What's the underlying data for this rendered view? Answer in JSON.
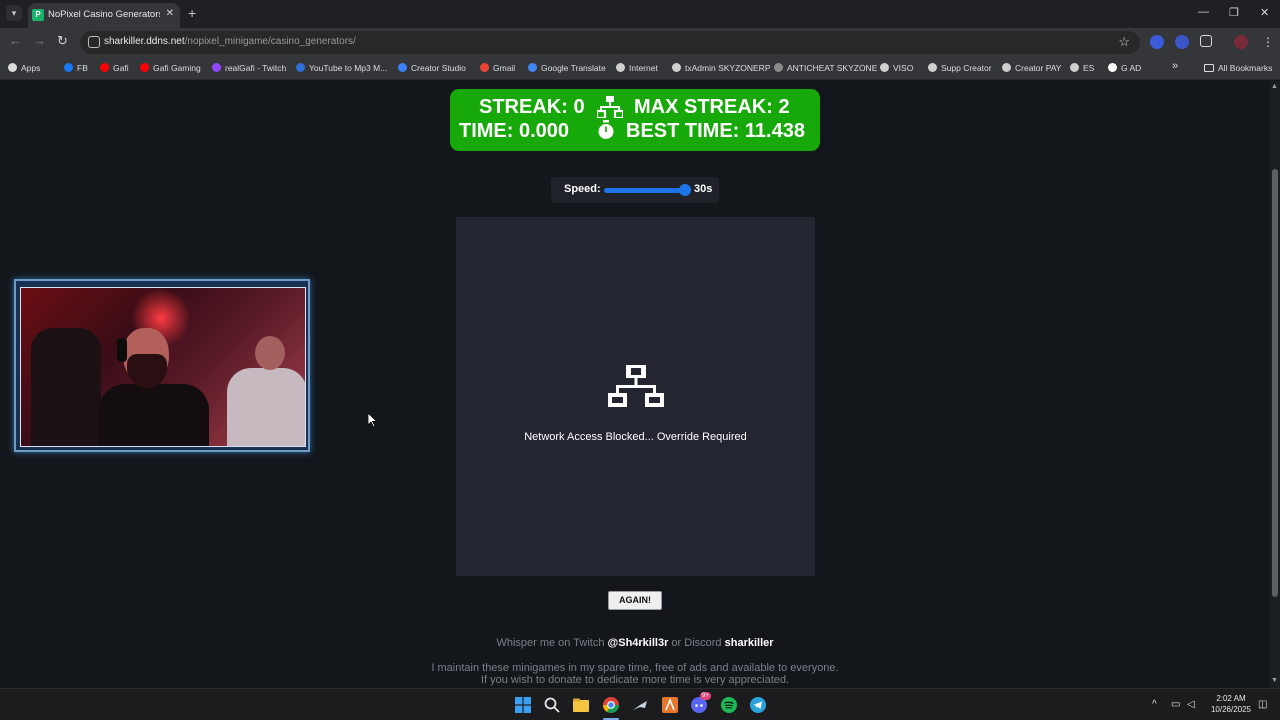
{
  "browser": {
    "tab_title": "NoPixel Casino Generators Mini",
    "url_host": "sharkiller.ddns.net",
    "url_path": "/nopixel_minigame/casino_generators/",
    "bookmarks": [
      {
        "label": "Apps",
        "icon": "apps-grid-icon",
        "color": "#dcdcdc"
      },
      {
        "label": "FB",
        "icon": "facebook-icon",
        "color": "#1877f2"
      },
      {
        "label": "Gafi",
        "icon": "youtube-icon",
        "color": "#ff0000"
      },
      {
        "label": "Gafi Gaming",
        "icon": "youtube-icon",
        "color": "#ff0000"
      },
      {
        "label": "realGafi - Twitch",
        "icon": "twitch-icon",
        "color": "#9146ff"
      },
      {
        "label": "YouTube to Mp3 M...",
        "icon": "download-icon",
        "color": "#2f6fd6"
      },
      {
        "label": "Creator Studio",
        "icon": "meta-icon",
        "color": "#3b82f6"
      },
      {
        "label": "Gmail",
        "icon": "gmail-icon",
        "color": "#ea4335"
      },
      {
        "label": "Google Translate",
        "icon": "translate-icon",
        "color": "#4285f4"
      },
      {
        "label": "Internet",
        "icon": "internet-icon",
        "color": "#cfcfcf"
      },
      {
        "label": "txAdmin SKYZONERP",
        "icon": "globe-icon",
        "color": "#cfcfcf"
      },
      {
        "label": "ANTICHEAT SKYZONE",
        "icon": "shield-icon",
        "color": "#8a8a8a"
      },
      {
        "label": "VISO",
        "icon": "globe-icon",
        "color": "#cfcfcf"
      },
      {
        "label": "Supp Creator",
        "icon": "link-icon",
        "color": "#cfcfcf"
      },
      {
        "label": "Creator PAY",
        "icon": "globe-icon",
        "color": "#cfcfcf"
      },
      {
        "label": "ES",
        "icon": "globe-icon",
        "color": "#cfcfcf"
      },
      {
        "label": "G AD",
        "icon": "google-icon",
        "color": "#ffffff"
      }
    ],
    "all_bookmarks": "All Bookmarks"
  },
  "stats": {
    "streak": "STREAK: 0",
    "max_streak": "MAX STREAK: 2",
    "time": "TIME:  0.000",
    "best_time": "BEST TIME:  11.438",
    "bg_color": "#17a90a"
  },
  "speed": {
    "label": "Speed:",
    "value_text": "30s",
    "level": 1.0
  },
  "game": {
    "message": "Network Access Blocked... Override Required",
    "again_label": "AGAIN!"
  },
  "footer": {
    "whisper_prefix": "Whisper me on Twitch ",
    "twitch_handle": "@Sh4rkill3r",
    "or_discord": " or Discord ",
    "discord_handle": "sharkiller",
    "line2": "I maintain these minigames in my spare time, free of ads and available to everyone.",
    "line3": "If you wish to donate to dedicate more time is very appreciated."
  },
  "taskbar": {
    "time": "2:02 AM",
    "date": "10/26/2025",
    "discord_badge": "9+"
  }
}
